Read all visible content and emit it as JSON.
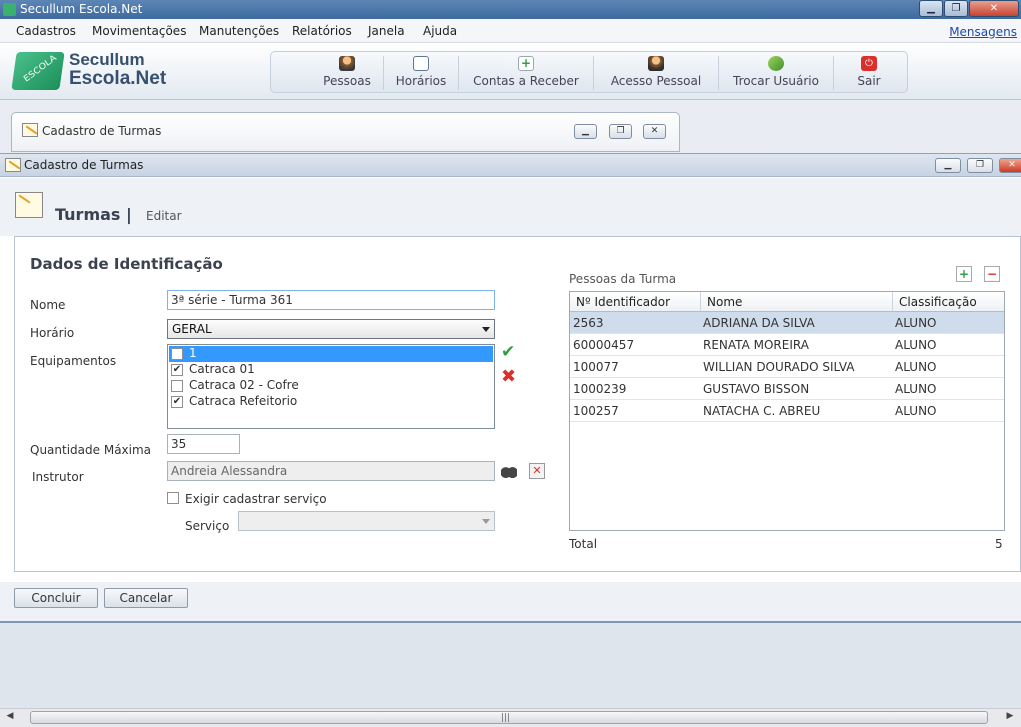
{
  "app": {
    "title": "Secullum Escola.Net"
  },
  "menu": [
    "Cadastros",
    "Movimentações",
    "Manutenções",
    "Relatórios",
    "Janela",
    "Ajuda"
  ],
  "menu_right": "Mensagens",
  "brand": {
    "line1": "Secullum",
    "line2": "Escola.Net",
    "logo_text": "ESCOLA"
  },
  "toolbar": [
    {
      "label": "Pessoas",
      "icon": "user-key-icon"
    },
    {
      "label": "Horários",
      "icon": "calendar-clock-icon"
    },
    {
      "label": "Contas a Receber",
      "icon": "add-document-icon"
    },
    {
      "label": "Acesso Pessoal",
      "icon": "user-access-icon"
    },
    {
      "label": "Trocar Usuário",
      "icon": "switch-user-icon"
    },
    {
      "label": "Sair",
      "icon": "power-icon"
    }
  ],
  "background_window": {
    "title": "Cadastro de Turmas"
  },
  "window": {
    "title": "Cadastro de Turmas"
  },
  "page": {
    "title": "Turmas |",
    "subtitle": "Editar"
  },
  "form": {
    "section_title": "Dados de Identificação",
    "nome_label": "Nome",
    "nome_value": "3ª série - Turma 361",
    "horario_label": "Horário",
    "horario_value": "GERAL",
    "equipamentos_label": "Equipamentos",
    "equipamentos": [
      {
        "label": "1",
        "checked": false,
        "selected": true
      },
      {
        "label": "Catraca 01",
        "checked": true,
        "selected": false
      },
      {
        "label": "Catraca 02 - Cofre",
        "checked": false,
        "selected": false
      },
      {
        "label": "Catraca Refeitorio",
        "checked": true,
        "selected": false
      }
    ],
    "qtd_label": "Quantidade Máxima",
    "qtd_value": "35",
    "instrutor_label": "Instrutor",
    "instrutor_value": "Andreia Alessandra",
    "exigir_label": "Exigir cadastrar serviço",
    "exigir_checked": false,
    "servico_label": "Serviço",
    "servico_value": ""
  },
  "pessoas": {
    "title": "Pessoas da Turma",
    "columns": [
      "Nº Identificador",
      "Nome",
      "Classificação"
    ],
    "rows": [
      {
        "id": "2563",
        "nome": "ADRIANA DA SILVA",
        "classificacao": "ALUNO"
      },
      {
        "id": "60000457",
        "nome": "RENATA MOREIRA",
        "classificacao": "ALUNO"
      },
      {
        "id": "100077",
        "nome": "WILLIAN DOURADO SILVA",
        "classificacao": "ALUNO"
      },
      {
        "id": "1000239",
        "nome": "GUSTAVO BISSON",
        "classificacao": "ALUNO"
      },
      {
        "id": "100257",
        "nome": "NATACHA C. ABREU",
        "classificacao": "ALUNO"
      }
    ],
    "total_label": "Total",
    "total_value": "5"
  },
  "buttons": {
    "concluir": "Concluir",
    "cancelar": "Cancelar"
  },
  "colors": {
    "accent_green": "#2f9e44",
    "delete_red": "#d9302c",
    "selection_blue": "#3399ff",
    "row_select": "#cfdcec"
  }
}
